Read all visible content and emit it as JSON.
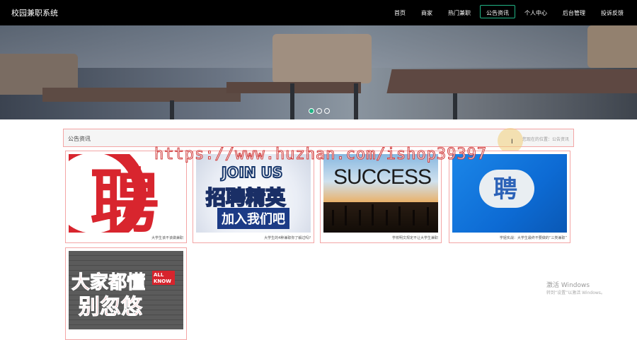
{
  "app": {
    "title": "校园兼职系统"
  },
  "nav": {
    "items": [
      {
        "label": "首页"
      },
      {
        "label": "商家"
      },
      {
        "label": "热门兼职"
      },
      {
        "label": "公告资讯"
      },
      {
        "label": "个人中心"
      },
      {
        "label": "后台管理"
      },
      {
        "label": "投诉反馈"
      }
    ],
    "active_index": 3,
    "accent_color": "#21b385"
  },
  "carousel": {
    "slide_count": 3,
    "active_index": 0
  },
  "section": {
    "title": "公告资讯",
    "breadcrumb": "您现在的位置：公告资讯"
  },
  "cards": [
    {
      "image_text": "聘",
      "caption": "大学生该不该做兼职"
    },
    {
      "image_text_top": "JOIN US",
      "image_text_main": "招聘精英",
      "image_text_sub": "加入我们吧",
      "caption": "大学生的4种兼职你了解过吗?"
    },
    {
      "image_text": "SUCCESS",
      "caption": "学校明文规定不让大学生兼职"
    },
    {
      "image_text": "聘",
      "caption": "学姐实战：大学生最终不要做的“三类兼职”"
    },
    {
      "image_text_top": "大家都懂",
      "image_badge": "ALL KNOW",
      "image_text_main": "别忽悠",
      "caption": ""
    }
  ],
  "watermark": "https://www.huzhan.com/ishop39397",
  "os_overlay": {
    "line1": "激活 Windows",
    "line2": "转到“设置”以激活 Windows。"
  }
}
